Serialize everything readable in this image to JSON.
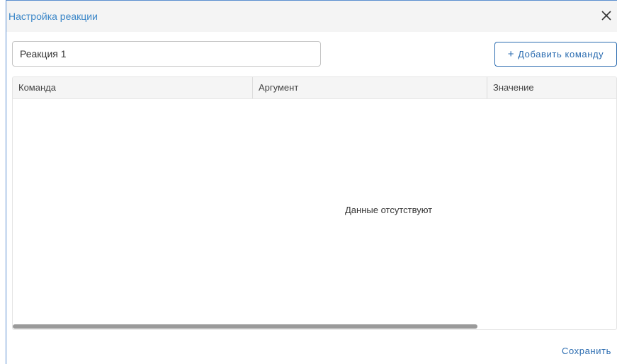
{
  "dialog": {
    "title": "Настройка реакции",
    "close_icon": "close-icon"
  },
  "reaction_name": {
    "value": "Реакция 1"
  },
  "add_command_button": {
    "icon": "plus-icon",
    "label": "Добавить команду"
  },
  "table": {
    "columns": [
      "Команда",
      "Аргумент",
      "Значение"
    ],
    "empty_text": "Данные отсутствуют"
  },
  "footer": {
    "save_label": "Сохранить"
  },
  "colors": {
    "accent": "#2b6cb0",
    "title": "#3a86c8"
  }
}
